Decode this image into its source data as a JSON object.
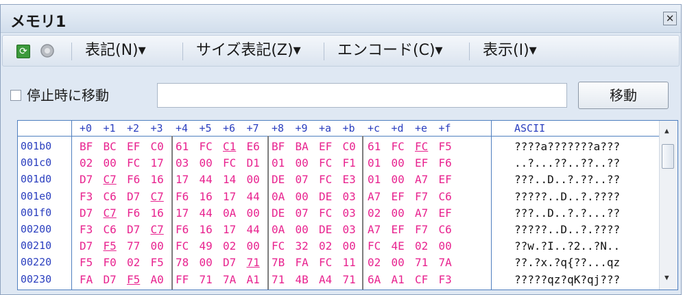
{
  "window": {
    "title": "メモリ1",
    "close_glyph": "✕"
  },
  "toolbar": {
    "items": [
      "表記(N)▾",
      "サイズ表記(Z)▾",
      "エンコード(C)▾",
      "表示(I)▾"
    ]
  },
  "search": {
    "checkbox_label": "停止時に移動",
    "address_value": "",
    "move_button": "移動"
  },
  "memory": {
    "header": {
      "offsets": [
        "+0",
        "+1",
        "+2",
        "+3",
        "+4",
        "+5",
        "+6",
        "+7",
        "+8",
        "+9",
        "+a",
        "+b",
        "+c",
        "+d",
        "+e",
        "+f"
      ],
      "ascii": "ASCII"
    },
    "rows": [
      {
        "addr": "001b0",
        "bytes": [
          "BF",
          "BC",
          "EF",
          "C0",
          "61",
          "FC",
          "C1",
          "E6",
          "BF",
          "BA",
          "EF",
          "C0",
          "61",
          "FC",
          "FC",
          "F5"
        ],
        "ascii": "????a???????a???"
      },
      {
        "addr": "001c0",
        "bytes": [
          "02",
          "00",
          "FC",
          "17",
          "03",
          "00",
          "FC",
          "D1",
          "01",
          "00",
          "FC",
          "F1",
          "01",
          "00",
          "EF",
          "F6"
        ],
        "ascii": "..?...??..??..??"
      },
      {
        "addr": "001d0",
        "bytes": [
          "D7",
          "C7",
          "F6",
          "16",
          "17",
          "44",
          "14",
          "00",
          "DE",
          "07",
          "FC",
          "E3",
          "01",
          "00",
          "A7",
          "EF"
        ],
        "ascii": "???..D..?.??..??"
      },
      {
        "addr": "001e0",
        "bytes": [
          "F3",
          "C6",
          "D7",
          "C7",
          "F6",
          "16",
          "17",
          "44",
          "0A",
          "00",
          "DE",
          "03",
          "A7",
          "EF",
          "F7",
          "C6"
        ],
        "ascii": "?????..D..?.????"
      },
      {
        "addr": "001f0",
        "bytes": [
          "D7",
          "C7",
          "F6",
          "16",
          "17",
          "44",
          "0A",
          "00",
          "DE",
          "07",
          "FC",
          "03",
          "02",
          "00",
          "A7",
          "EF"
        ],
        "ascii": "???..D..?.?...??"
      },
      {
        "addr": "00200",
        "bytes": [
          "F3",
          "C6",
          "D7",
          "C7",
          "F6",
          "16",
          "17",
          "44",
          "0A",
          "00",
          "DE",
          "03",
          "A7",
          "EF",
          "F7",
          "C6"
        ],
        "ascii": "?????..D..?.????"
      },
      {
        "addr": "00210",
        "bytes": [
          "D7",
          "F5",
          "77",
          "00",
          "FC",
          "49",
          "02",
          "00",
          "FC",
          "32",
          "02",
          "00",
          "FC",
          "4E",
          "02",
          "00"
        ],
        "ascii": "??w.?I..?2..?N.."
      },
      {
        "addr": "00220",
        "bytes": [
          "F5",
          "F0",
          "02",
          "F5",
          "78",
          "00",
          "D7",
          "71",
          "7B",
          "FA",
          "FC",
          "11",
          "02",
          "00",
          "71",
          "7A"
        ],
        "ascii": "??.?x.?q{??...qz"
      },
      {
        "addr": "00230",
        "bytes": [
          "FA",
          "D7",
          "F5",
          "A0",
          "FF",
          "71",
          "7A",
          "A1",
          "71",
          "4B",
          "A4",
          "71",
          "6A",
          "A1",
          "CF",
          "F3"
        ],
        "ascii": "?????qz?qK?qj???"
      }
    ],
    "underlined": [
      [
        0,
        6
      ],
      [
        0,
        14
      ],
      [
        2,
        1
      ],
      [
        3,
        3
      ],
      [
        4,
        1
      ],
      [
        5,
        3
      ],
      [
        6,
        1
      ],
      [
        7,
        7
      ],
      [
        8,
        2
      ]
    ],
    "colors": {
      "byte": "#e8238f",
      "addr": "#2b3fbf",
      "border": "#4f7fbf"
    }
  },
  "scrollbar": {
    "up_glyph": "▲",
    "down_glyph": "▼"
  }
}
